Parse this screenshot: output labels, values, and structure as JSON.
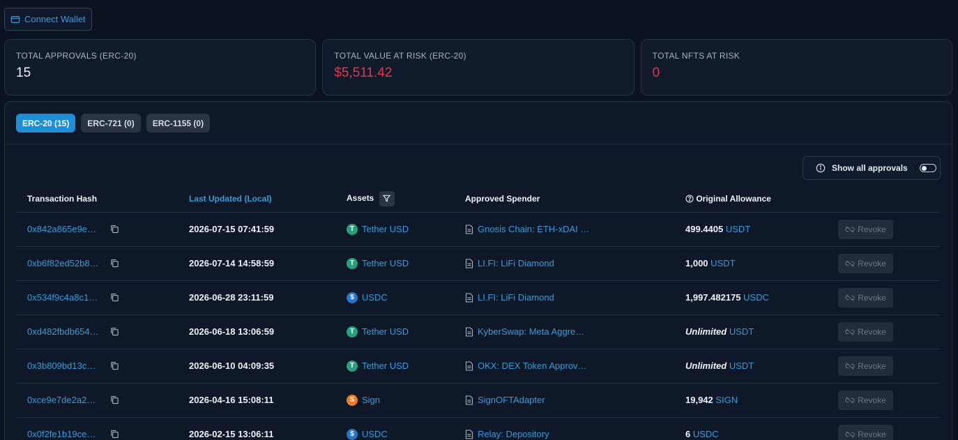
{
  "header": {
    "connect_label": "Connect Wallet"
  },
  "cards": [
    {
      "label": "TOTAL APPROVALS (ERC-20)",
      "value": "15",
      "risk": false
    },
    {
      "label": "TOTAL VALUE AT RISK (ERC-20)",
      "value": "$5,511.42",
      "risk": true
    },
    {
      "label": "TOTAL NFTS AT RISK",
      "value": "0",
      "risk": true
    }
  ],
  "tabs": [
    {
      "label": "ERC-20 (15)",
      "active": true
    },
    {
      "label": "ERC-721 (0)",
      "active": false
    },
    {
      "label": "ERC-1155 (0)",
      "active": false
    }
  ],
  "toggle": {
    "label": "Show all approvals",
    "on": false
  },
  "table": {
    "columns": [
      "Transaction Hash",
      "Last Updated (Local)",
      "Assets",
      "Approved Spender",
      "Original Allowance"
    ],
    "rows": [
      {
        "hash": "0x842a865e9e…",
        "date": "2026-07-15 07:41:59",
        "asset": "Tether USD",
        "asset_icon": "tether-icon",
        "spender": "Gnosis Chain: ETH-xDAI …",
        "amount": "499.4405",
        "unit": "USDT",
        "unlimited": false,
        "revoke": "Revoke"
      },
      {
        "hash": "0xb6f82ed52b8…",
        "date": "2026-07-14 14:58:59",
        "asset": "Tether USD",
        "asset_icon": "tether-icon",
        "spender": "LI.FI: LiFi Diamond",
        "amount": "1,000",
        "unit": "USDT",
        "unlimited": false,
        "revoke": "Revoke"
      },
      {
        "hash": "0x534f9c4a8c1…",
        "date": "2026-06-28 23:11:59",
        "asset": "USDC",
        "asset_icon": "usdc-icon",
        "spender": "LI.FI: LiFi Diamond",
        "amount": "1,997.482175",
        "unit": "USDC",
        "unlimited": false,
        "revoke": "Revoke"
      },
      {
        "hash": "0xd482fbdb654…",
        "date": "2026-06-18 13:06:59",
        "asset": "Tether USD",
        "asset_icon": "tether-icon",
        "spender": "KyberSwap: Meta Aggre…",
        "amount": "Unlimited",
        "unit": "USDT",
        "unlimited": true,
        "revoke": "Revoke"
      },
      {
        "hash": "0x3b809bd13c…",
        "date": "2026-06-10 04:09:35",
        "asset": "Tether USD",
        "asset_icon": "tether-icon",
        "spender": "OKX: DEX Token Approv…",
        "amount": "Unlimited",
        "unit": "USDT",
        "unlimited": true,
        "revoke": "Revoke"
      },
      {
        "hash": "0xce9e7de2a2…",
        "date": "2026-04-16 15:08:11",
        "asset": "Sign",
        "asset_icon": "sign-icon",
        "spender": "SignOFTAdapter",
        "amount": "19,942",
        "unit": "SIGN",
        "unlimited": false,
        "revoke": "Revoke"
      },
      {
        "hash": "0x0f2fe1b19ce…",
        "date": "2026-02-15 13:06:11",
        "asset": "USDC",
        "asset_icon": "usdc-icon",
        "spender": "Relay: Depository",
        "amount": "6",
        "unit": "USDC",
        "unlimited": false,
        "revoke": "Revoke"
      }
    ]
  }
}
